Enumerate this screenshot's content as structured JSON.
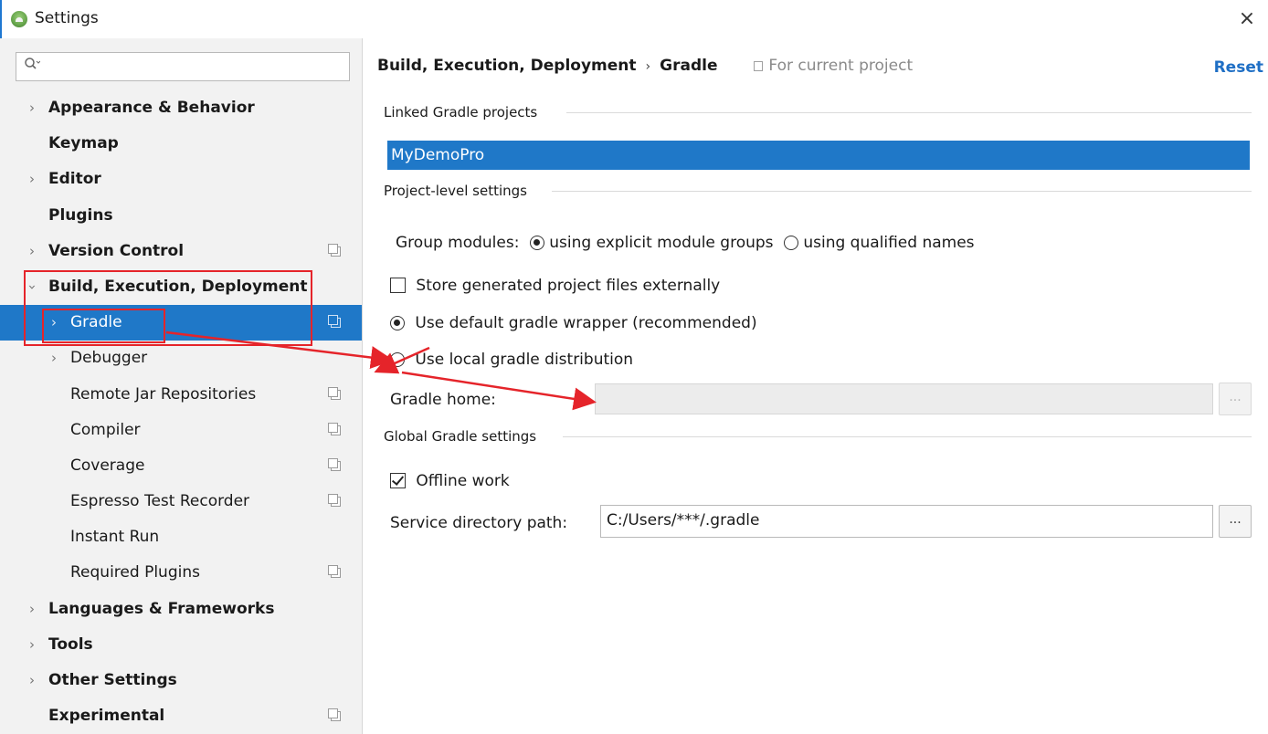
{
  "window": {
    "title": "Settings",
    "close_glyph": "×"
  },
  "search": {
    "icon": "search-icon",
    "placeholder": "",
    "value": ""
  },
  "sidebar": {
    "items": [
      {
        "label": "Appearance & Behavior",
        "chevron": "right",
        "copy_icon": false
      },
      {
        "label": "Keymap",
        "chevron": "none",
        "copy_icon": false
      },
      {
        "label": "Editor",
        "chevron": "right",
        "copy_icon": false
      },
      {
        "label": "Plugins",
        "chevron": "none",
        "copy_icon": false
      },
      {
        "label": "Version Control",
        "chevron": "right",
        "copy_icon": true
      },
      {
        "label": "Build, Execution, Deployment",
        "chevron": "down",
        "copy_icon": false
      },
      {
        "label": "Gradle",
        "chevron": "right",
        "copy_icon": true,
        "selected": true
      },
      {
        "label": "Debugger",
        "chevron": "right",
        "copy_icon": false
      },
      {
        "label": "Remote Jar Repositories",
        "chevron": "none",
        "copy_icon": true
      },
      {
        "label": "Compiler",
        "chevron": "none",
        "copy_icon": true
      },
      {
        "label": "Coverage",
        "chevron": "none",
        "copy_icon": true
      },
      {
        "label": "Espresso Test Recorder",
        "chevron": "none",
        "copy_icon": true
      },
      {
        "label": "Instant Run",
        "chevron": "none",
        "copy_icon": false
      },
      {
        "label": "Required Plugins",
        "chevron": "none",
        "copy_icon": true
      },
      {
        "label": "Languages & Frameworks",
        "chevron": "right",
        "copy_icon": false
      },
      {
        "label": "Tools",
        "chevron": "right",
        "copy_icon": false
      },
      {
        "label": "Other Settings",
        "chevron": "right",
        "copy_icon": false
      },
      {
        "label": "Experimental",
        "chevron": "none",
        "copy_icon": true
      }
    ]
  },
  "header": {
    "crumb_parent": "Build, Execution, Deployment",
    "crumb_sep": "›",
    "crumb_current": "Gradle",
    "scope": "For current project",
    "reset": "Reset"
  },
  "linked": {
    "title": "Linked Gradle projects",
    "projects": [
      "MyDemoPro"
    ]
  },
  "project_level": {
    "title": "Project-level settings",
    "group_modules_label": "Group modules:",
    "group_option_explicit": "using explicit module groups",
    "group_option_qualified": "using qualified names",
    "store_external_label": "Store generated project files externally",
    "use_default_wrapper_label": "Use default gradle wrapper (recommended)",
    "use_local_distribution_label": "Use local gradle distribution",
    "gradle_home_label": "Gradle home:",
    "gradle_home_value": "",
    "browse_label": "..."
  },
  "global": {
    "title": "Global Gradle settings",
    "offline_work_label": "Offline work",
    "service_dir_label": "Service directory path:",
    "service_dir_value": "C:/Users/***/.gradle",
    "browse_label": "..."
  },
  "colors": {
    "selection": "#1f78c8",
    "link": "#1f6fc5",
    "annotation": "#e5242a"
  }
}
